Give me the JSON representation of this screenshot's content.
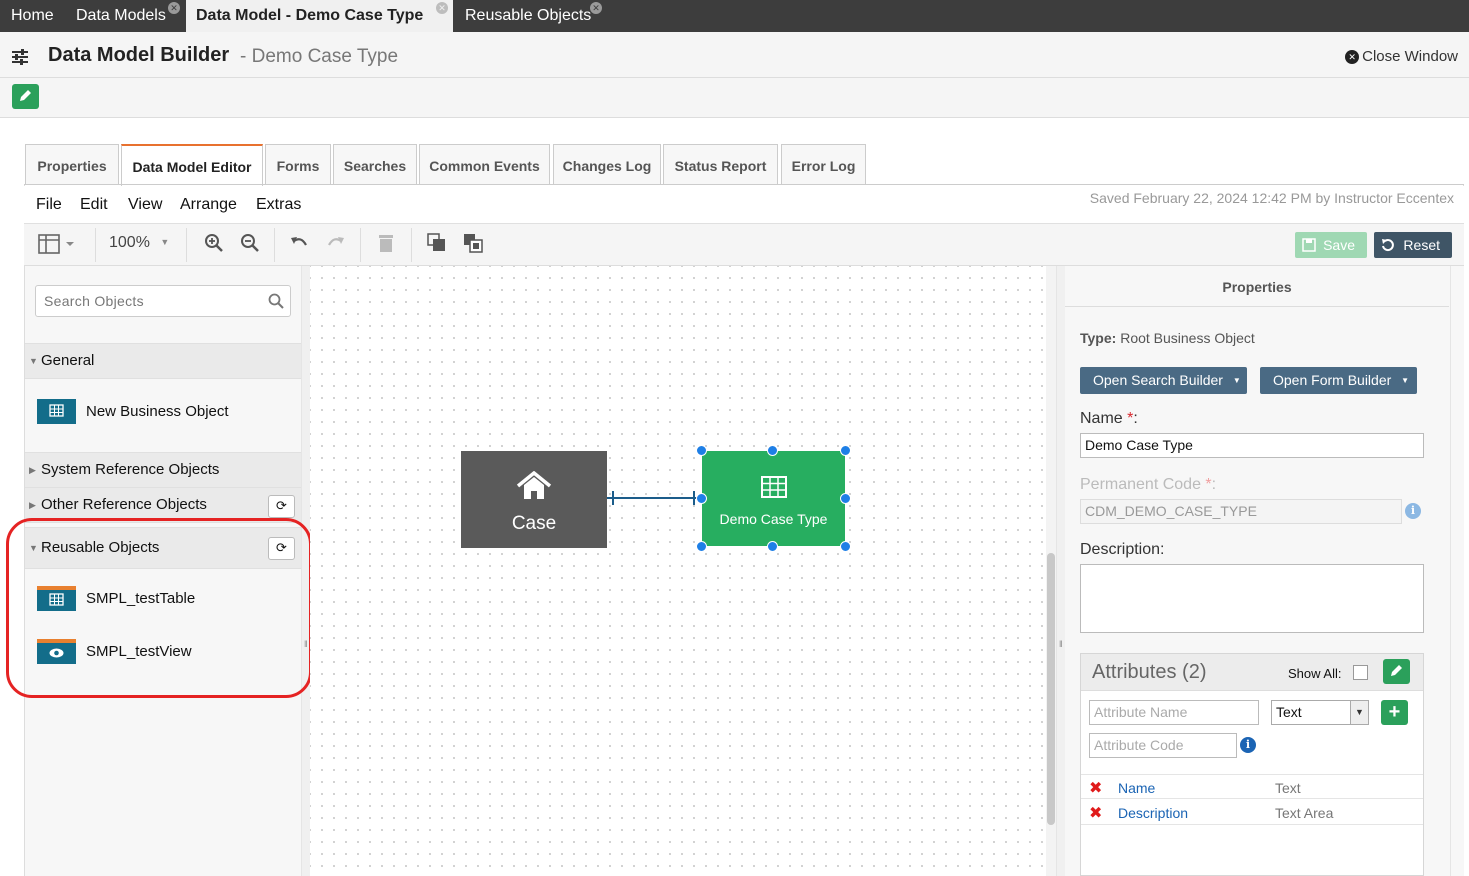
{
  "top_tabs": [
    {
      "label": "Home"
    },
    {
      "label": "Data Models"
    },
    {
      "label": "Data Model - Demo Case Type"
    },
    {
      "label": "Reusable Objects"
    }
  ],
  "header": {
    "title": "Data Model Builder",
    "subtitle": "- Demo Case Type",
    "close_label": "Close Window"
  },
  "main_tabs": [
    {
      "label": "Properties"
    },
    {
      "label": "Data Model Editor"
    },
    {
      "label": "Forms"
    },
    {
      "label": "Searches"
    },
    {
      "label": "Common Events"
    },
    {
      "label": "Changes Log"
    },
    {
      "label": "Status Report"
    },
    {
      "label": "Error Log"
    }
  ],
  "menu": [
    "File",
    "Edit",
    "View",
    "Arrange",
    "Extras"
  ],
  "saved_text": "Saved February 22, 2024 12:42 PM by Instructor Eccentex",
  "toolbar": {
    "zoom": "100%",
    "save_label": "Save",
    "reset_label": "Reset"
  },
  "left_panel": {
    "search_placeholder": "Search Objects",
    "sections": [
      {
        "label": "General",
        "expanded": true,
        "items": [
          {
            "label": "New Business Object",
            "icon": "table-icon"
          }
        ]
      },
      {
        "label": "System Reference Objects",
        "expanded": false
      },
      {
        "label": "Other Reference Objects",
        "expanded": false
      },
      {
        "label": "Reusable Objects",
        "expanded": true,
        "items": [
          {
            "label": "SMPL_testTable",
            "icon": "table-icon"
          },
          {
            "label": "SMPL_testView",
            "icon": "eye-icon"
          }
        ]
      }
    ]
  },
  "canvas": {
    "nodes": [
      {
        "label": "Case",
        "icon": "home-icon",
        "color": "#5a5a5a"
      },
      {
        "label": "Demo Case Type",
        "icon": "table-icon",
        "color": "#27ae60",
        "selected": true
      }
    ]
  },
  "properties": {
    "heading": "Properties",
    "type_label": "Type:",
    "type_value": "Root Business Object",
    "open_search_builder": "Open Search Builder",
    "open_form_builder": "Open Form Builder",
    "name_label": "Name",
    "name_value": "Demo Case Type",
    "permanent_code_label": "Permanent Code",
    "permanent_code_value": "CDM_DEMO_CASE_TYPE",
    "description_label": "Description:",
    "description_value": "",
    "attributes": {
      "title": "Attributes (2)",
      "show_all_label": "Show All:",
      "attribute_name_placeholder": "Attribute Name",
      "attribute_type_selected": "Text",
      "attribute_code_placeholder": "Attribute Code",
      "rows": [
        {
          "name": "Name",
          "type": "Text"
        },
        {
          "name": "Description",
          "type": "Text Area"
        }
      ]
    }
  },
  "colors": {
    "accent_green": "#27ae60",
    "tab_accent": "#e8712f",
    "selection_blue": "#1e7fe6",
    "dark_button": "#3f5566",
    "highlight_ring": "#e52323"
  }
}
